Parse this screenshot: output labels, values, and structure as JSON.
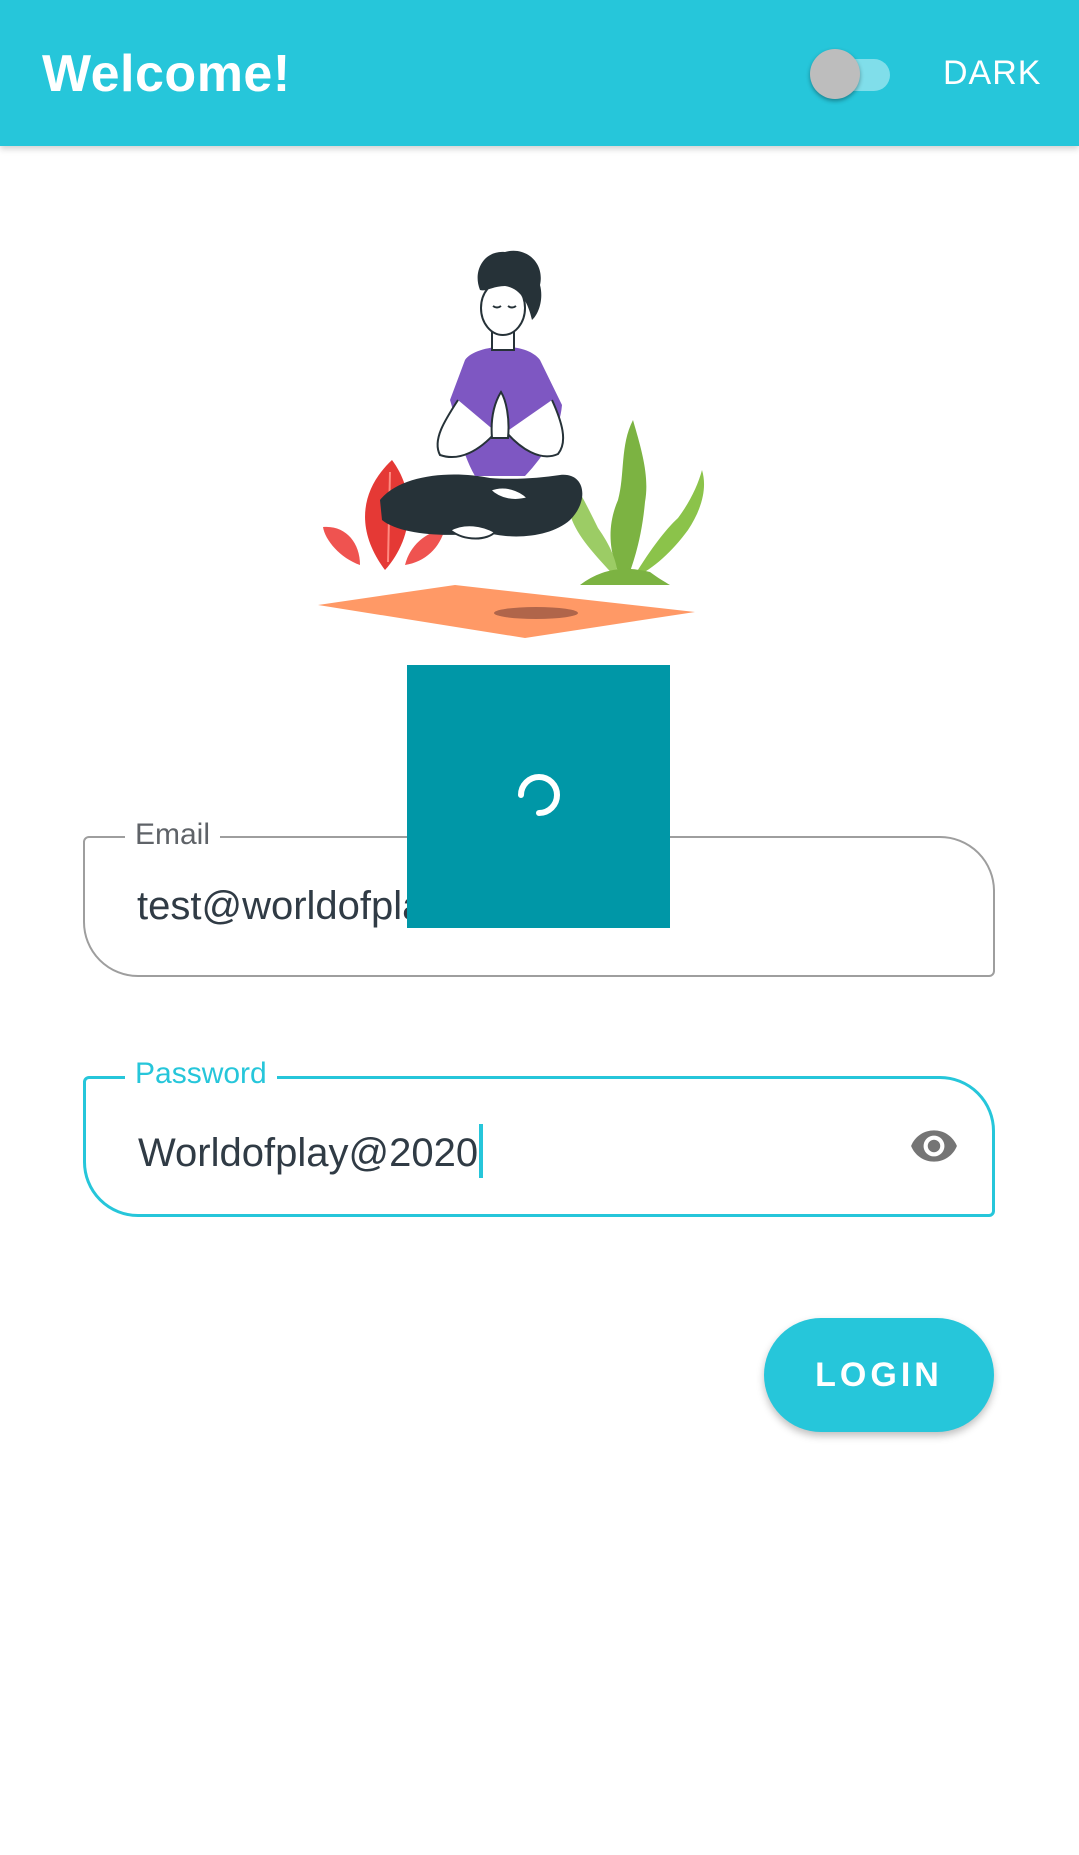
{
  "appbar": {
    "title": "Welcome!",
    "theme_toggle": {
      "label": "DARK",
      "enabled": false
    },
    "colors": {
      "primary": "#26C6DA"
    }
  },
  "illustration": {
    "icon": "meditation-illustration"
  },
  "form": {
    "email": {
      "label": "Email",
      "value": "test@worldofplay.in"
    },
    "password": {
      "label": "Password",
      "value": "Worldofplay@2020",
      "visibility_icon": "eye-icon"
    },
    "login_label": "LOGIN"
  },
  "loading": {
    "visible": true,
    "color": "#0097A7",
    "icon": "spinner-icon"
  }
}
